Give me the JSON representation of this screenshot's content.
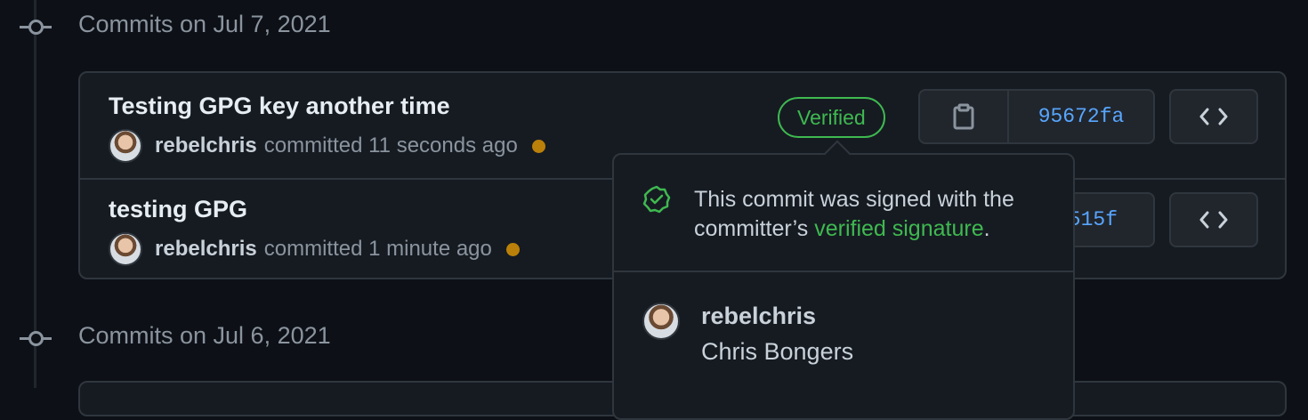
{
  "groups": [
    {
      "title": "Commits on Jul 7, 2021"
    },
    {
      "title": "Commits on Jul 6, 2021"
    }
  ],
  "commits": [
    {
      "message": "Testing GPG key another time",
      "author": "rebelchris",
      "verb": "committed",
      "time": "11 seconds ago",
      "verified": "Verified",
      "sha": "95672fa"
    },
    {
      "message": "testing GPG",
      "author": "rebelchris",
      "verb": "committed",
      "time": "1 minute ago",
      "sha": "515f"
    }
  ],
  "popover": {
    "text_before": "This commit was signed with the committer’s ",
    "link": "verified signature",
    "text_after": ".",
    "login": "rebelchris",
    "full_name": "Chris Bongers"
  },
  "icons": {
    "copy": "clipboard-icon",
    "browse": "code-icon",
    "verified": "verified-check-icon",
    "timeline": "commit-node-icon"
  },
  "colors": {
    "background": "#0d1117",
    "card": "#161b22",
    "border": "#30363d",
    "verified": "#3fb950",
    "sha": "#58a6ff",
    "status_pending": "#bb8009"
  }
}
